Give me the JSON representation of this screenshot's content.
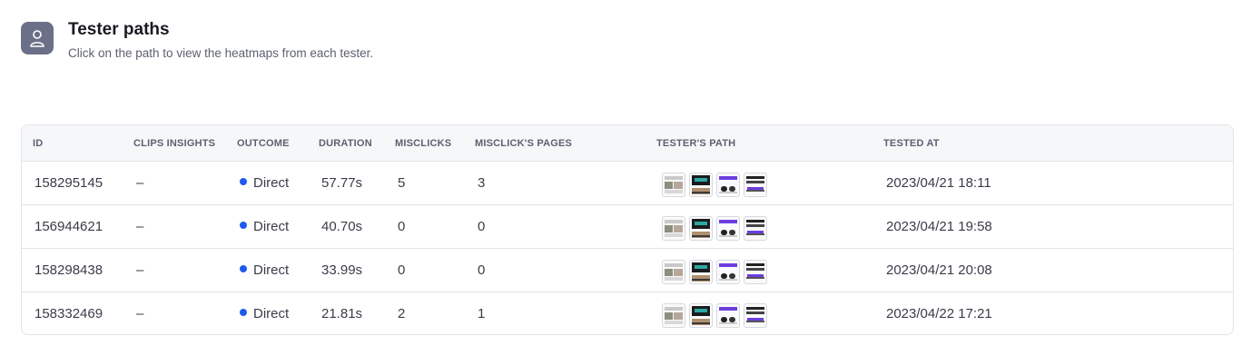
{
  "header": {
    "icon": "user-icon",
    "title": "Tester paths",
    "subtitle": "Click on the path to view the heatmaps from each tester."
  },
  "table": {
    "columns": [
      "ID",
      "CLIPS INSIGHTS",
      "OUTCOME",
      "DURATION",
      "MISCLICKS",
      "MISCLICK'S PAGES",
      "TESTER'S PATH",
      "TESTED AT"
    ],
    "rows": [
      {
        "id": "158295145",
        "clips": "–",
        "outcome": "Direct",
        "duration": "57.77s",
        "misclicks": "5",
        "pages": "3",
        "tested_at": "2023/04/21 18:11"
      },
      {
        "id": "156944621",
        "clips": "–",
        "outcome": "Direct",
        "duration": "40.70s",
        "misclicks": "0",
        "pages": "0",
        "tested_at": "2023/04/21 19:58"
      },
      {
        "id": "158298438",
        "clips": "–",
        "outcome": "Direct",
        "duration": "33.99s",
        "misclicks": "0",
        "pages": "0",
        "tested_at": "2023/04/21 20:08"
      },
      {
        "id": "158332469",
        "clips": "–",
        "outcome": "Direct",
        "duration": "21.81s",
        "misclicks": "2",
        "pages": "1",
        "tested_at": "2023/04/22 17:21"
      }
    ]
  },
  "colors": {
    "outcome_direct": "#1f5af0",
    "icon_bg": "#6b7088"
  }
}
